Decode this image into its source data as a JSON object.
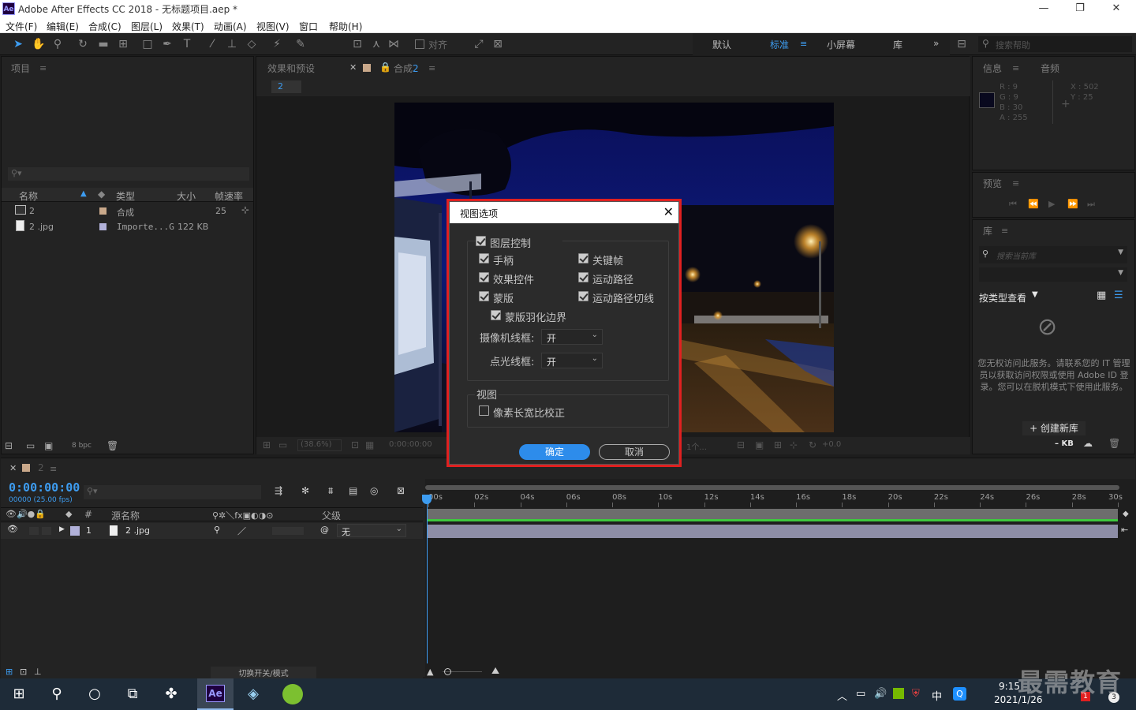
{
  "window": {
    "app_logo": "Ae",
    "title": "Adobe After Effects CC 2018 - 无标题项目.aep *",
    "minimize": "—",
    "restore": "❐",
    "close": "✕"
  },
  "menu": [
    "文件(F)",
    "编辑(E)",
    "合成(C)",
    "图层(L)",
    "效果(T)",
    "动画(A)",
    "视图(V)",
    "窗口",
    "帮助(H)"
  ],
  "toolbar": {
    "align_label": "对齐",
    "workspaces": [
      "默认",
      "标准",
      "小屏幕",
      "库"
    ],
    "active_workspace": "标准",
    "help_search_placeholder": "搜索帮助"
  },
  "project": {
    "tab": "项目",
    "columns": {
      "name": "名称",
      "type": "类型",
      "size": "大小",
      "fps": "帧速率"
    },
    "items": [
      {
        "name": "2",
        "type": "合成",
        "size": "",
        "fps": "25"
      },
      {
        "name": "2 .jpg",
        "type": "Importe...G",
        "size": "122 KB",
        "fps": ""
      }
    ],
    "bpc": "8 bpc"
  },
  "comp": {
    "tab_effects": "效果和预设",
    "tab_comp": "合成",
    "tab_comp_num": "2",
    "breadcrumb": "2",
    "zoom": "(38.6%)",
    "timecode": "0:00:00:00",
    "exposure": "+0.0",
    "views_label": "1个..."
  },
  "info": {
    "tab": "信息",
    "tab2": "音频",
    "r": "R : 9",
    "g": "G : 9",
    "b": "B : 30",
    "a": "A : 255",
    "x": "X : 502",
    "y": "Y : 25",
    "swatch_color": "#09091e"
  },
  "preview": {
    "tab": "预览"
  },
  "library": {
    "tab": "库",
    "search_placeholder": "搜索当前库",
    "view_by": "按类型查看",
    "message": "您无权访问此服务。请联系您的 IT 管理员以获取访问权限或使用 Adobe ID 登录。您可以在脱机模式下使用此服务。",
    "create_btn": "+ 创建新库",
    "kb": "– KB"
  },
  "timeline": {
    "tab_num": "2",
    "timecode": "0:00:00:00",
    "frames": "00000 (25.00 fps)",
    "col_num": "#",
    "col_source": "源名称",
    "col_parent": "父级",
    "layer": {
      "num": "1",
      "name": "2 .jpg",
      "parent": "无"
    },
    "ruler": [
      "00s",
      "02s",
      "04s",
      "06s",
      "08s",
      "10s",
      "12s",
      "14s",
      "16s",
      "18s",
      "20s",
      "22s",
      "24s",
      "26s",
      "28s",
      "30s"
    ],
    "toggle_label": "切换开关/模式"
  },
  "dialog": {
    "title": "视图选项",
    "layer_controls": "图层控制",
    "handles": "手柄",
    "keyframes": "关键帧",
    "effect_controls": "效果控件",
    "motion_paths": "运动路径",
    "masks": "蒙版",
    "motion_path_tangents": "运动路径切线",
    "mask_feather": "蒙版羽化边界",
    "camera_wireframes_label": "摄像机线框:",
    "camera_wireframes_value": "开",
    "light_wireframes_label": "点光线框:",
    "light_wireframes_value": "开",
    "view_section": "视图",
    "pixel_aspect": "像素长宽比校正",
    "ok": "确定",
    "cancel": "取消"
  },
  "taskbar": {
    "time": "9:15",
    "date": "2021/1/26",
    "lang": "中",
    "ae_label": "Ae",
    "notify_count": "3",
    "badge_count": "1"
  },
  "watermark": "最需教育"
}
